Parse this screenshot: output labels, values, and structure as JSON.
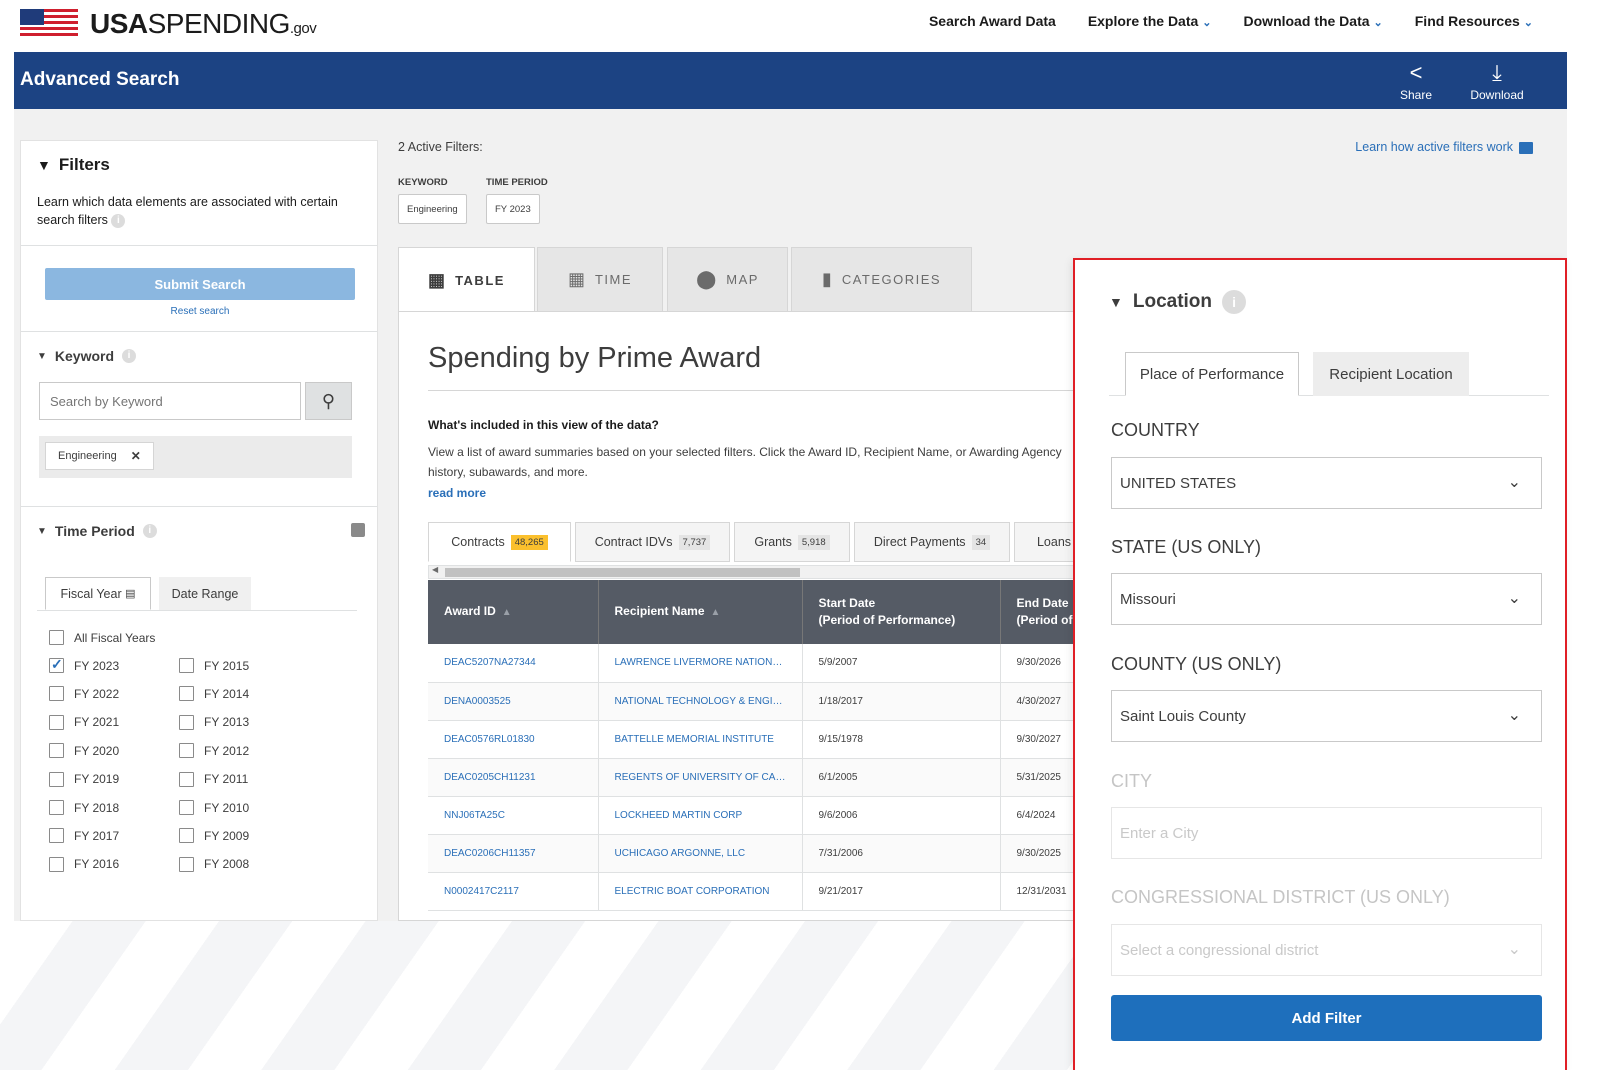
{
  "site": {
    "logo_bold": "USA",
    "logo_rest": "SPENDING",
    "logo_gov": ".gov"
  },
  "nav": {
    "items": [
      {
        "label": "Search Award Data",
        "dropdown": false
      },
      {
        "label": "Explore the Data",
        "dropdown": true
      },
      {
        "label": "Download the Data",
        "dropdown": true
      },
      {
        "label": "Find Resources",
        "dropdown": true
      }
    ]
  },
  "banner": {
    "title": "Advanced Search",
    "share_label": "Share",
    "download_label": "Download"
  },
  "filters": {
    "title": "Filters",
    "description": "Learn which data elements are associated with certain search filters",
    "submit_label": "Submit Search",
    "reset_label": "Reset search",
    "keyword": {
      "title": "Keyword",
      "placeholder": "Search by Keyword",
      "tags": [
        "Engineering"
      ]
    },
    "time_period": {
      "title": "Time Period",
      "tab_fiscal": "Fiscal Year",
      "tab_range": "Date Range",
      "all_label": "All Fiscal Years",
      "left_years": [
        {
          "label": "FY 2023",
          "checked": true
        },
        {
          "label": "FY 2022",
          "checked": false
        },
        {
          "label": "FY 2021",
          "checked": false
        },
        {
          "label": "FY 2020",
          "checked": false
        },
        {
          "label": "FY 2019",
          "checked": false
        },
        {
          "label": "FY 2018",
          "checked": false
        },
        {
          "label": "FY 2017",
          "checked": false
        },
        {
          "label": "FY 2016",
          "checked": false
        }
      ],
      "right_years": [
        {
          "label": "FY 2015",
          "checked": false
        },
        {
          "label": "FY 2014",
          "checked": false
        },
        {
          "label": "FY 2013",
          "checked": false
        },
        {
          "label": "FY 2012",
          "checked": false
        },
        {
          "label": "FY 2011",
          "checked": false
        },
        {
          "label": "FY 2010",
          "checked": false
        },
        {
          "label": "FY 2009",
          "checked": false
        },
        {
          "label": "FY 2008",
          "checked": false
        }
      ]
    }
  },
  "active_filters": {
    "label": "2 Active Filters:",
    "learn_link": "Learn how active filters work",
    "keyword_heading": "KEYWORD",
    "keyword_value": "Engineering",
    "time_heading": "TIME PERIOD",
    "time_value": "FY 2023"
  },
  "view_tabs": [
    "TABLE",
    "TIME",
    "MAP",
    "CATEGORIES"
  ],
  "panel": {
    "title": "Spending by Prime Award",
    "whats_included": "What's included in this view of the data?",
    "description": "View a list of award summaries based on your selected filters. Click the Award ID, Recipient Name, or Awarding Agency",
    "description_cont": "history, subawards, and more.",
    "read_more": "read more"
  },
  "award_tabs": [
    {
      "label": "Contracts",
      "count": "48,265",
      "active": true
    },
    {
      "label": "Contract IDVs",
      "count": "7,737",
      "active": false
    },
    {
      "label": "Grants",
      "count": "5,918",
      "active": false
    },
    {
      "label": "Direct Payments",
      "count": "34",
      "active": false
    },
    {
      "label": "Loans",
      "count": "",
      "active": false
    }
  ],
  "table": {
    "headers": [
      "Award ID",
      "Recipient Name",
      "Start Date",
      "(Period of Performance)",
      "End Date",
      "(Period of"
    ],
    "rows": [
      [
        "DEAC5207NA27344",
        "LAWRENCE LIVERMORE NATIONAL SECURITY, LLC",
        "5/9/2007",
        "9/30/2026"
      ],
      [
        "DENA0003525",
        "NATIONAL TECHNOLOGY & ENGINEERING SOLUTIONS",
        "1/18/2017",
        "4/30/2027"
      ],
      [
        "DEAC0576RL01830",
        "BATTELLE MEMORIAL INSTITUTE",
        "9/15/1978",
        "9/30/2027"
      ],
      [
        "DEAC0205CH11231",
        "REGENTS OF UNIVERSITY OF CALIFORNIA",
        "6/1/2005",
        "5/31/2025"
      ],
      [
        "NNJ06TA25C",
        "LOCKHEED MARTIN CORP",
        "9/6/2006",
        "6/4/2024"
      ],
      [
        "DEAC0206CH11357",
        "UCHICAGO ARGONNE, LLC",
        "7/31/2006",
        "9/30/2025"
      ],
      [
        "N0002417C2117",
        "ELECTRIC BOAT CORPORATION",
        "9/21/2017",
        "12/31/2031"
      ]
    ]
  },
  "location": {
    "title": "Location",
    "tab_place": "Place of Performance",
    "tab_recipient": "Recipient Location",
    "country_label": "COUNTRY",
    "country_value": "UNITED STATES",
    "state_label": "STATE (US ONLY)",
    "state_value": "Missouri",
    "county_label": "COUNTY (US ONLY)",
    "county_value": "Saint Louis County",
    "city_label": "CITY",
    "city_placeholder": "Enter a City",
    "district_label": "CONGRESSIONAL DISTRICT (US ONLY)",
    "district_placeholder": "Select a congressional district",
    "add_label": "Add Filter"
  },
  "colors": {
    "banner": "#1c4383",
    "link": "#2a6fb8",
    "highlight_border": "#e01f26",
    "count_highlight": "#fbc02d"
  }
}
